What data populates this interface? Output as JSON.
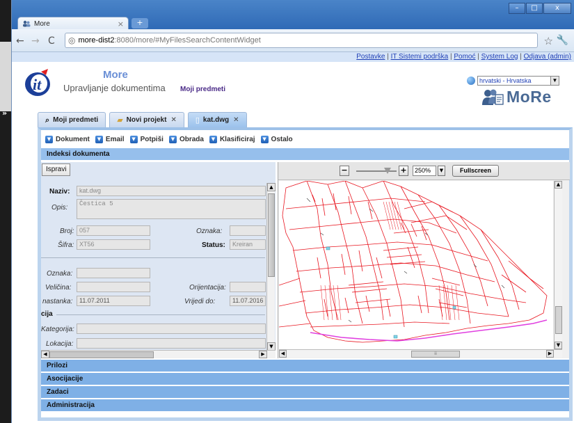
{
  "browser": {
    "tab_title": "More",
    "url_host": "more-dist2",
    "url_rest": ":8080/more/#MyFilesSearchContentWidget"
  },
  "toplinks": {
    "postavke": "Postavke",
    "it_podrska": "IT Sistemi podrška",
    "pomoc": "Pomoć",
    "system_log": "System Log",
    "odjava": "Odjava (admin)"
  },
  "header": {
    "app_name": "More",
    "subtitle": "Upravljanje dokumentima",
    "section": "Moji predmeti",
    "language": "hrvatski - Hrvatska",
    "brand": "MoRe"
  },
  "tabs": [
    {
      "label": "Moji predmeti"
    },
    {
      "label": "Novi projekt"
    },
    {
      "label": "kat.dwg"
    }
  ],
  "menu": [
    {
      "label": "Dokument"
    },
    {
      "label": "Email"
    },
    {
      "label": "Potpiši"
    },
    {
      "label": "Obrada"
    },
    {
      "label": "Klasificiraj"
    },
    {
      "label": "Ostalo"
    }
  ],
  "sections": {
    "indeksi": "Indeksi dokumenta",
    "prilozi": "Prilozi",
    "asocijacije": "Asocijacije",
    "zadaci": "Zadaci",
    "administracija": "Administracija"
  },
  "form": {
    "ispravi": "Ispravi",
    "naziv_label": "Naziv:",
    "naziv_value": "kat.dwg",
    "opis_label": "Opis:",
    "opis_value": "Čestica 5",
    "broj_label": "Broj:",
    "broj_value": "057",
    "oznaka_label": "Oznaka:",
    "sifra_label": "Šifra:",
    "sifra_value": "XT56",
    "status_label": "Status:",
    "status_value": "Kreiran",
    "oznaka2_label": "Oznaka:",
    "velicina_label": "Veličina:",
    "orijentacija_label": "Orijentacija:",
    "nastanka_label": "nastanka:",
    "nastanka_value": "11.07.2011",
    "vrijedi_label": "Vrijedi do:",
    "vrijedi_value": "11.07.2016",
    "group_label": "cija",
    "kategorija_label": "Kategorija:",
    "lokacija_label": "Lokacija:"
  },
  "viewer": {
    "zoom": "250%",
    "fullscreen": "Fullscreen",
    "zoom_slider_fraction": 0.78
  },
  "colors": {
    "section_bar": "#96bfec",
    "map_lines": "#e8141e",
    "map_road": "#e040e0"
  }
}
